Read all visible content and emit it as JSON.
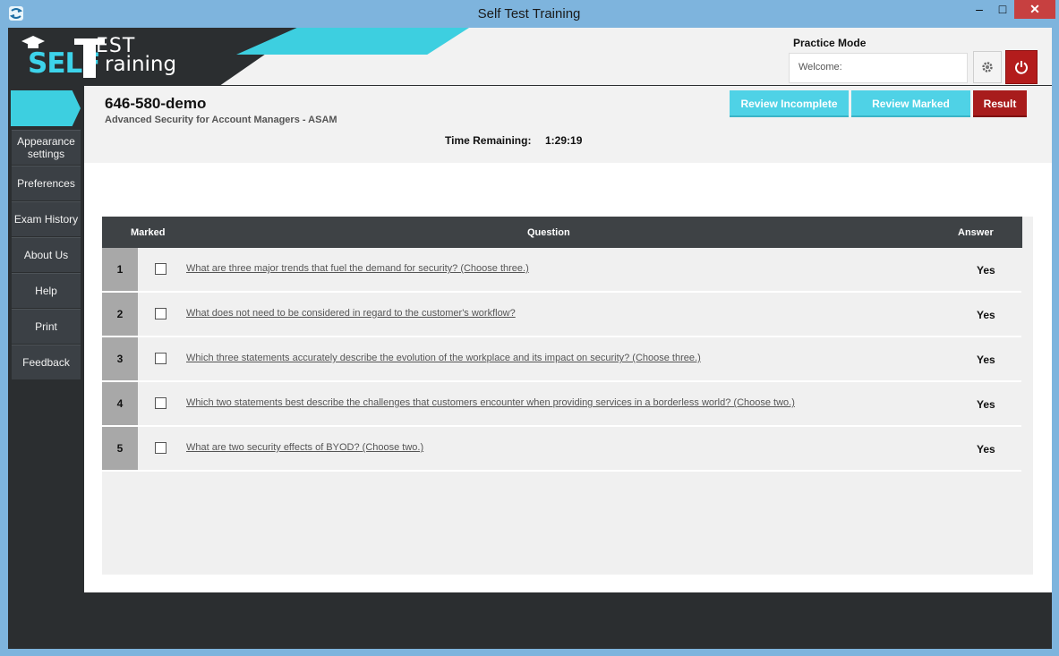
{
  "window": {
    "title": "Self Test Training",
    "minimize_glyph": "–",
    "maximize_glyph": "□",
    "close_glyph": "✕"
  },
  "logo": {
    "self": "SELF",
    "test": "EST",
    "training": "raining"
  },
  "header": {
    "mode": "Practice Mode",
    "welcome_label": "Welcome:",
    "settings_icon": "gear-icon",
    "power_icon": "power-icon"
  },
  "sidebar": {
    "items": [
      {
        "label": "Appearance settings"
      },
      {
        "label": "Preferences"
      },
      {
        "label": "Exam History"
      },
      {
        "label": "About Us"
      },
      {
        "label": "Help"
      },
      {
        "label": "Print"
      },
      {
        "label": "Feedback"
      }
    ]
  },
  "exam": {
    "code": "646-580-demo",
    "name": "Advanced Security for Account Managers - ASAM",
    "time_label": "Time Remaining:",
    "time_value": "1:29:19"
  },
  "buttons": {
    "review_incomplete": "Review Incomplete",
    "review_marked": "Review Marked",
    "result": "Result"
  },
  "table": {
    "columns": {
      "marked": "Marked",
      "question": "Question",
      "answer": "Answer"
    },
    "rows": [
      {
        "num": "1",
        "marked": false,
        "question": "What are three major trends that fuel the demand for security? (Choose three.)",
        "answer": "Yes"
      },
      {
        "num": "2",
        "marked": false,
        "question": "What does not need to be considered in regard to the customer's workflow?",
        "answer": "Yes"
      },
      {
        "num": "3",
        "marked": false,
        "question": "Which three statements accurately describe the evolution of the workplace and its impact on security? (Choose three.)",
        "answer": "Yes"
      },
      {
        "num": "4",
        "marked": false,
        "question": "Which two statements best describe the challenges that customers encounter when providing services in a borderless world? (Choose two.)",
        "answer": "Yes"
      },
      {
        "num": "5",
        "marked": false,
        "question": "What are two security effects of BYOD? (Choose two.)",
        "answer": "Yes"
      }
    ]
  },
  "colors": {
    "accent_cyan": "#3dcfe0",
    "dark_panel": "#2b2e30",
    "result_red": "#a81c1c"
  }
}
